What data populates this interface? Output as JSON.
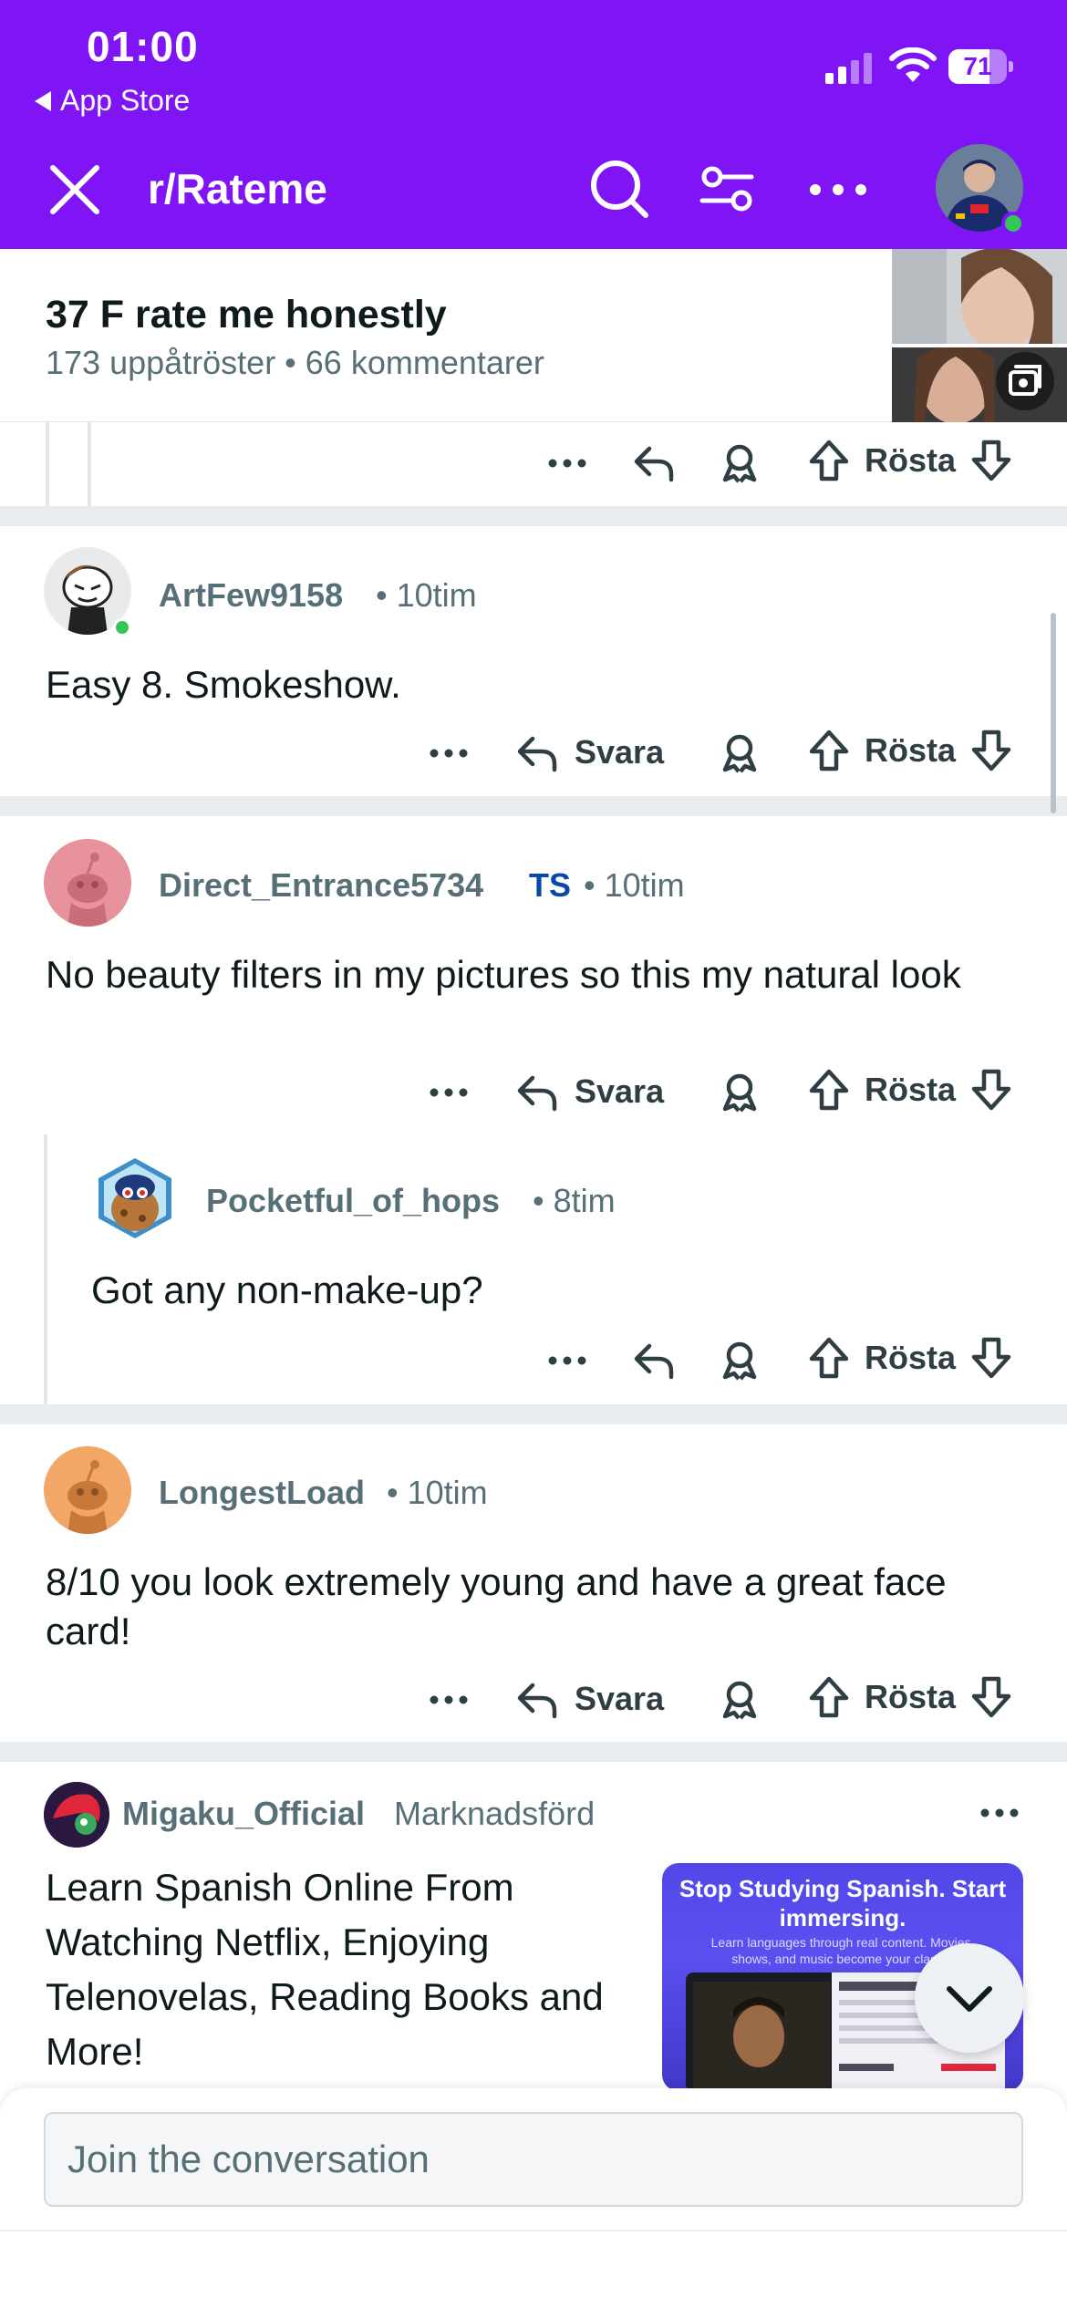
{
  "status_bar": {
    "time": "01:00",
    "back_app": "App Store",
    "battery": "71",
    "battery_level_percent": 71
  },
  "header": {
    "subreddit": "r/Rateme"
  },
  "post": {
    "title": "37 F rate me honestly",
    "meta": "173 uppåtröster • 66 kommentarer"
  },
  "actions": {
    "reply": "Svara",
    "vote": "Rösta"
  },
  "comments": [
    {
      "username": "ArtFew9158",
      "sep_time": "• 10tim",
      "body": "Easy 8. Smokeshow."
    },
    {
      "username": "Direct_Entrance5734",
      "op_badge": "TS",
      "sep_time": "• 10tim",
      "body": "No beauty filters in my pictures so this my natural look"
    },
    {
      "username": "Pocketful_of_hops",
      "sep_time": "• 8tim",
      "body": "Got any non-make-up?"
    },
    {
      "username": "LongestLoad",
      "sep_time": "• 10tim",
      "body": "8/10 you look extremely young and have a great face card!"
    }
  ],
  "ad": {
    "advertiser": "Migaku_Official",
    "label": "Marknadsförd",
    "text": "Learn Spanish Online From Watching Netflix, Enjoying Telenovelas, Reading Books and More!",
    "image_headline": "Stop Studying Spanish. Start immersing.",
    "image_subline": "Learn languages through real content. Movies, shows, and music become your class..."
  },
  "composer": {
    "placeholder": "Join the conversation"
  },
  "colors": {
    "header": "#7f14f5",
    "meta_text": "#576f76",
    "op_badge": "#0a47a8",
    "online": "#33c758"
  }
}
